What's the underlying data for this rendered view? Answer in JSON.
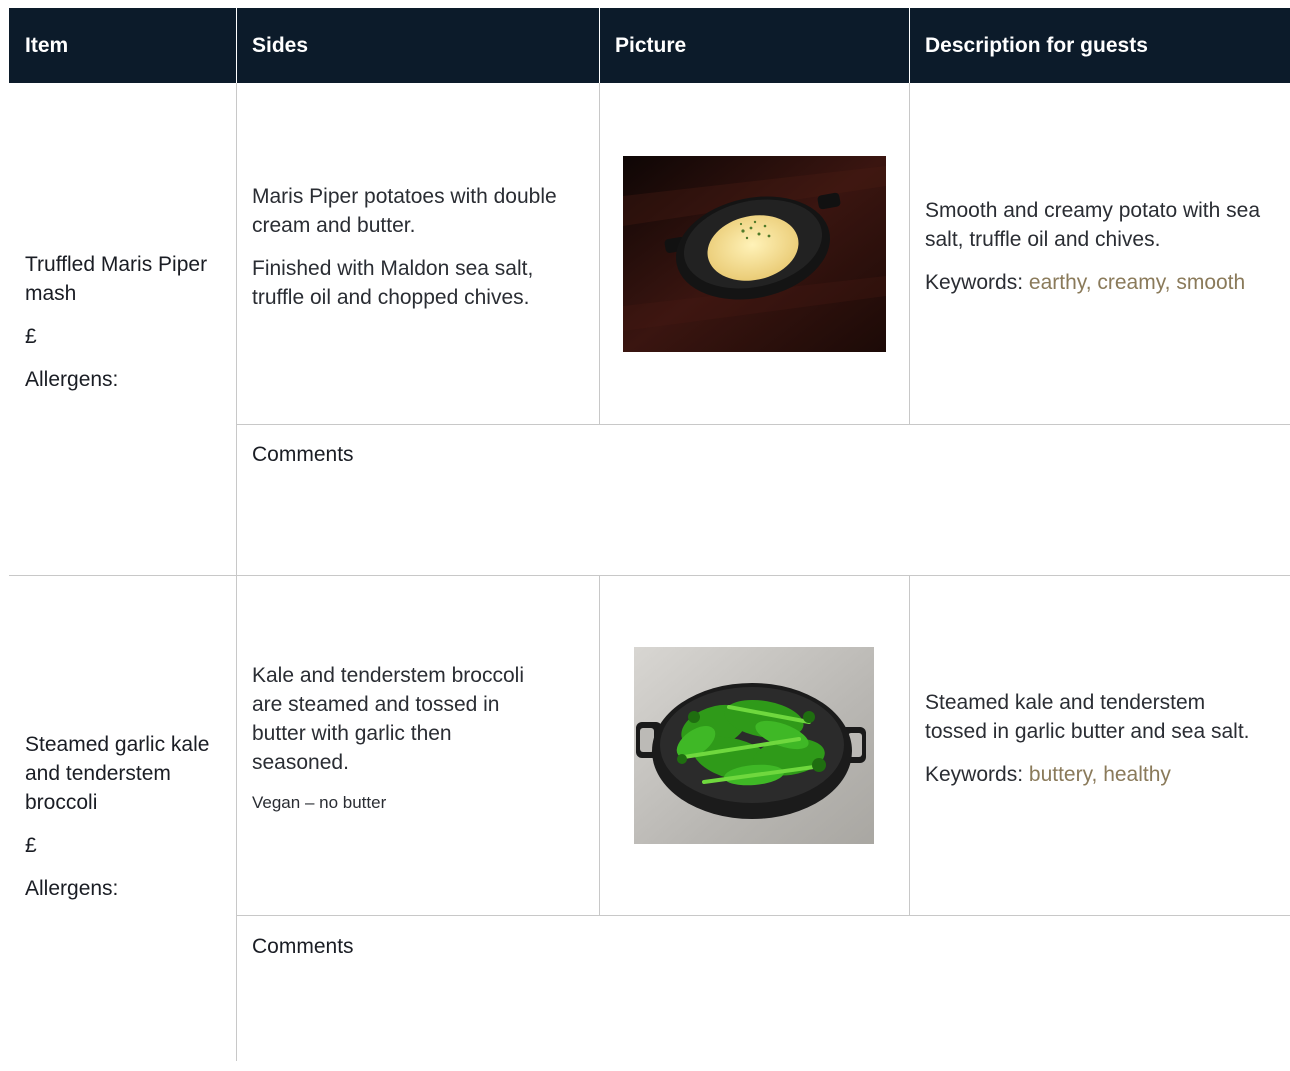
{
  "header": {
    "col_item": "Item",
    "col_sides": "Sides",
    "col_picture": "Picture",
    "col_description": "Description for guests"
  },
  "rows": [
    {
      "name": "Truffled Maris Piper mash",
      "price": "£",
      "allergens": "Allergens:",
      "sides_p1": "Maris Piper potatoes with double cream and butter.",
      "sides_p2": "Finished with Maldon sea salt, truffle oil and chopped chives.",
      "description": "Smooth and creamy potato with sea salt, truffle oil and chives.",
      "keywords_label": "Keywords:",
      "keywords": "earthy, creamy, smooth",
      "comments": "Comments"
    },
    {
      "name": "Steamed garlic kale and tenderstem broccoli",
      "price": "£",
      "allergens": "Allergens:",
      "sides_p1": "Kale and tenderstem broccoli are steamed and tossed in butter with garlic then seasoned.",
      "sides_note": "Vegan – no butter",
      "description": "Steamed kale and tenderstem tossed in garlic butter and sea salt.",
      "keywords_label": "Keywords:",
      "keywords": "buttery, healthy",
      "comments": "Comments"
    }
  ],
  "colors": {
    "header_bg": "#0c1b2a",
    "keyword": "#8a7a5a",
    "grid": "#c8c8c8"
  }
}
